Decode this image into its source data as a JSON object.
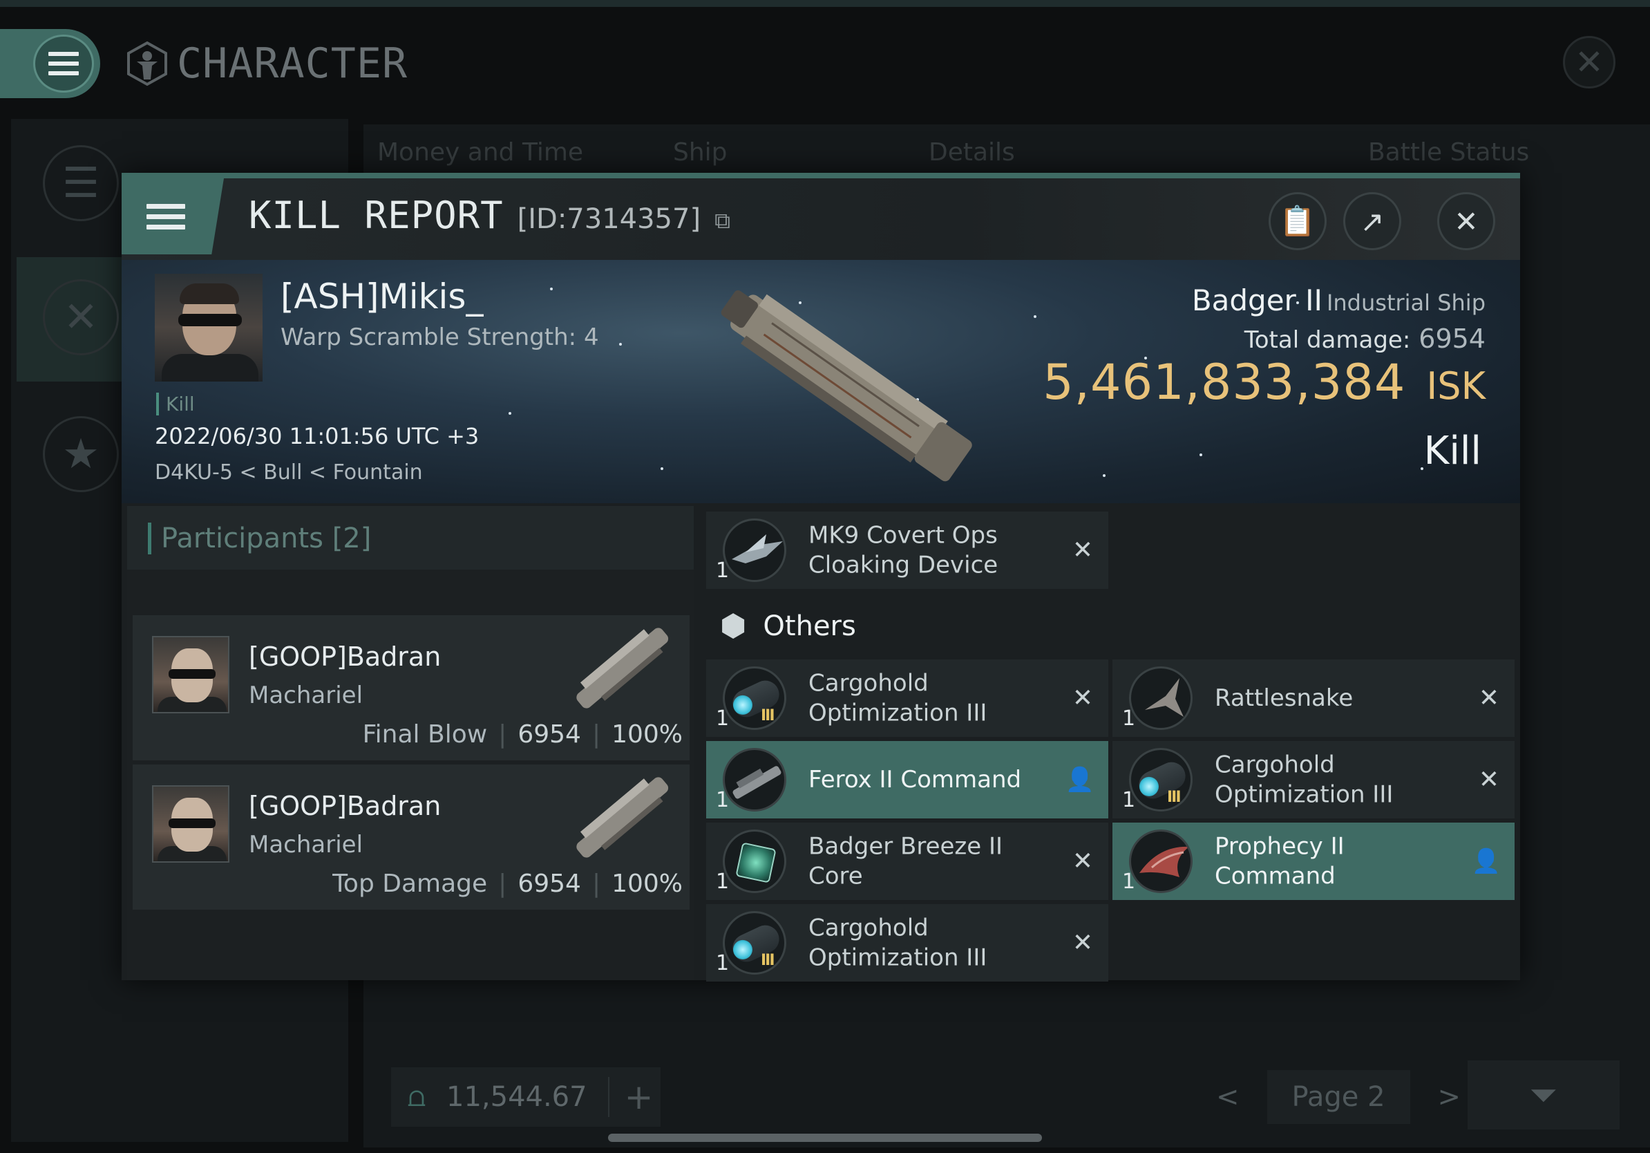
{
  "app": {
    "title": "CHARACTER",
    "close_icon": "close-icon"
  },
  "background": {
    "tabs": [
      "Money and Time",
      "Ship",
      "Details",
      "Battle Status"
    ],
    "wallet_value": "11,544.67",
    "wallet_add": "+",
    "page_label": "Page 2",
    "prev_label": "<",
    "next_label": ">"
  },
  "kill_report": {
    "title": "KILL REPORT",
    "id_label": "[ID:7314357]",
    "victim": {
      "name": "[ASH]Mikis_",
      "warp_scramble": "Warp Scramble Strength: 4",
      "tag": "Kill",
      "datetime": "2022/06/30 11:01:56 UTC +3",
      "location": "D4KU-5 < Bull < Fountain",
      "ship_name": "Badger II",
      "ship_class": "Industrial Ship",
      "total_damage_label": "Total damage:",
      "total_damage": "6954",
      "isk_value": "5,461,833,384",
      "isk_unit": "ISK",
      "status": "Kill"
    },
    "participants": {
      "label": "Participants",
      "count": "[2]",
      "rows": [
        {
          "name": "[GOOP]Badran",
          "ship": "Machariel",
          "role": "Final Blow",
          "damage": "6954",
          "percent": "100%"
        },
        {
          "name": "[GOOP]Badran",
          "ship": "Machariel",
          "role": "Top Damage",
          "damage": "6954",
          "percent": "100%"
        }
      ]
    },
    "items": {
      "top_item": {
        "qty": "1",
        "name_line1": "MK9 Covert Ops",
        "name_line2": "Cloaking Device"
      },
      "others_label": "Others",
      "left": [
        {
          "qty": "1",
          "name_line1": "Cargohold",
          "name_line2": "Optimization III"
        },
        {
          "qty": "1",
          "name_line1": "Ferox II Command",
          "name_line2": ""
        },
        {
          "qty": "1",
          "name_line1": "Badger Breeze II",
          "name_line2": "Core"
        },
        {
          "qty": "1",
          "name_line1": "Cargohold",
          "name_line2": "Optimization III"
        }
      ],
      "right": [
        {
          "qty": "1",
          "name_line1": "Rattlesnake",
          "name_line2": ""
        },
        {
          "qty": "1",
          "name_line1": "Cargohold",
          "name_line2": "Optimization III"
        },
        {
          "qty": "1",
          "name_line1": "Prophecy II",
          "name_line2": "Command"
        }
      ]
    }
  },
  "colors": {
    "accent": "#3f6b64",
    "isk": "#e8c27a",
    "panel": "#22282a"
  }
}
